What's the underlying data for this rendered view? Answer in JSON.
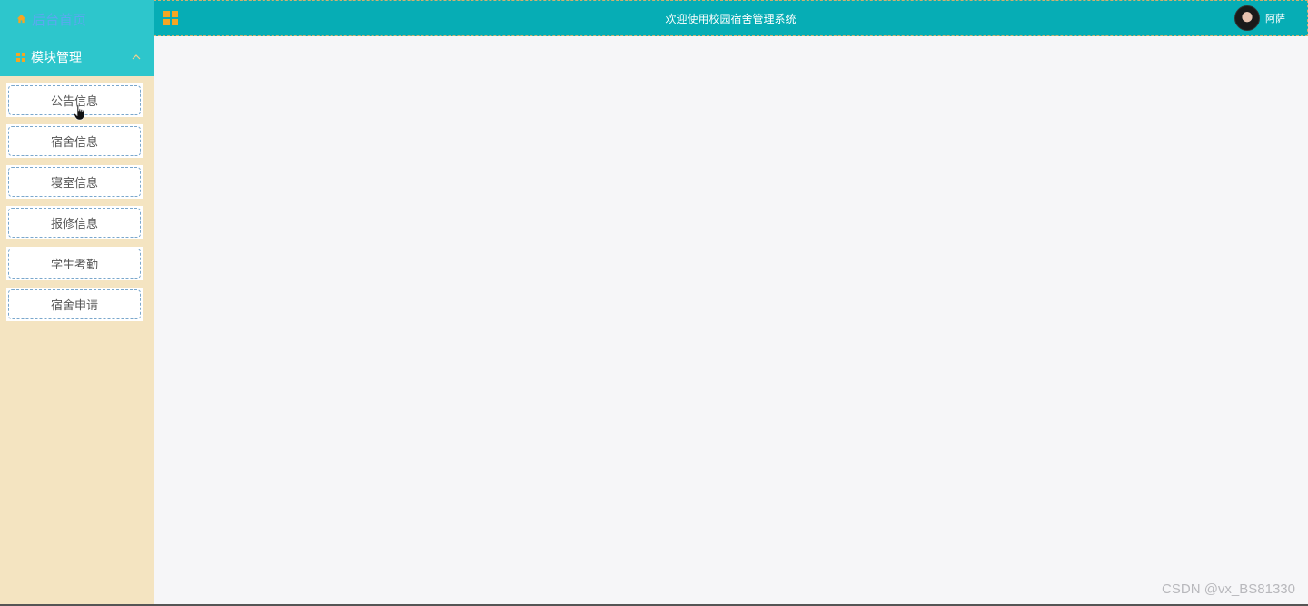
{
  "sidebar": {
    "home_label": "后台首页",
    "group_label": "模块管理",
    "items": [
      {
        "label": "公告信息"
      },
      {
        "label": "宿舍信息"
      },
      {
        "label": "寝室信息"
      },
      {
        "label": "报修信息"
      },
      {
        "label": "学生考勤"
      },
      {
        "label": "宿舍申请"
      }
    ]
  },
  "header": {
    "title": "欢迎使用校园宿舍管理系统",
    "user_name": "阿萨"
  },
  "watermark": "CSDN @vx_BS81330",
  "colors": {
    "sidebar_bg": "#f4e4c1",
    "sidebar_header_bg": "#2dc6cc",
    "topbar_bg": "#06adb5",
    "accent_icon": "#f5a623",
    "main_bg": "#f6f6f8"
  },
  "icons": {
    "home": "home-icon",
    "group": "grid-icon",
    "chevron": "chevron-up-icon",
    "menu_toggle": "grid-menu-icon"
  }
}
